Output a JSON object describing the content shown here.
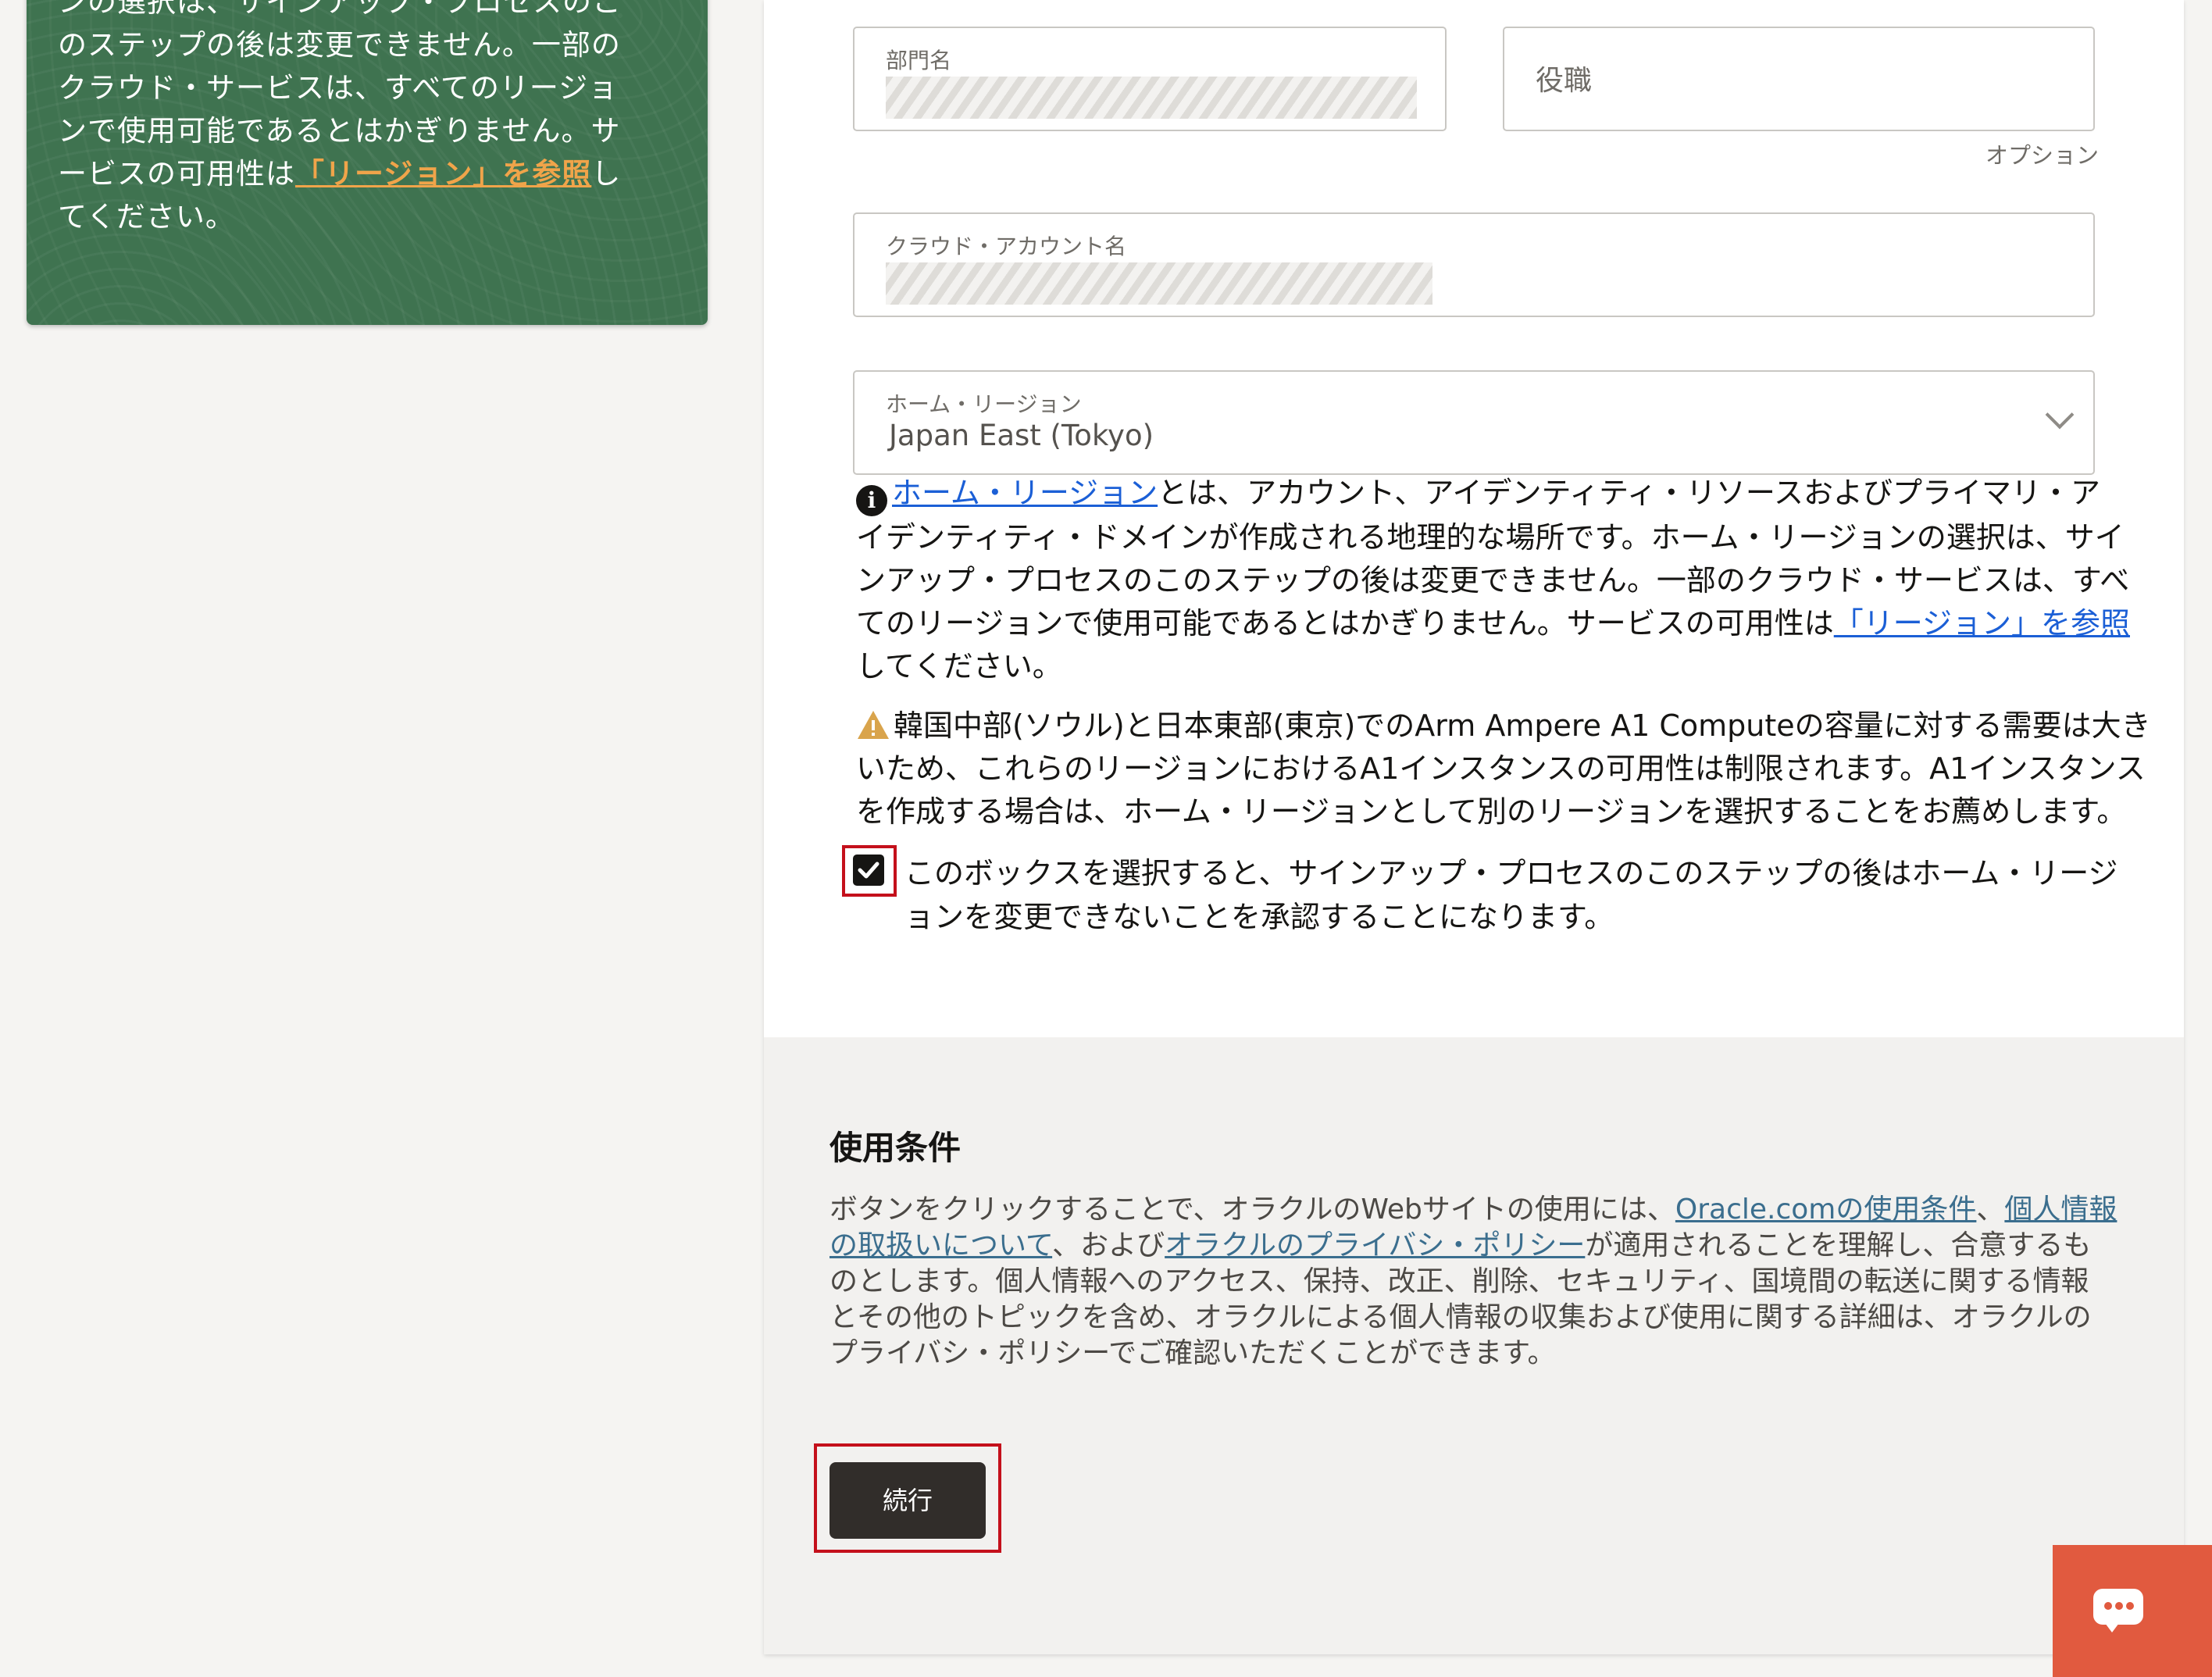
{
  "sidebar_note": {
    "lines": [
      "ンの選択は、サインアップ・プロセスのこ",
      "のステップの後は変更できません。一部の",
      "クラウド・サービスは、すべてのリージョ",
      "ンで使用可能であるとはかぎりません。サ"
    ],
    "line5_prefix": "ービスの可用性は",
    "line5_link": "「リージョン」を参照",
    "line5_suffix": "し",
    "line6": "てください。"
  },
  "form": {
    "department": {
      "label": "部門名"
    },
    "job_title": {
      "placeholder": "役職",
      "optional_label": "オプション"
    },
    "cloud_account": {
      "label": "クラウド・アカウント名"
    },
    "home_region": {
      "label": "ホーム・リージョン",
      "value": "Japan East (Tokyo)"
    }
  },
  "info_note": {
    "link_text": "ホーム・リージョン",
    "line1_rest": "とは、アカウント、アイデンティティ・リソースおよびプライマリ・ア",
    "line2": "イデンティティ・ドメインが作成される地理的な場所です。ホーム・リージョンの選択は、サイ",
    "line3": "ンアップ・プロセスのこのステップの後は変更できません。一部のクラウド・サービスは、すべ",
    "line4_prefix": "てのリージョンで使用可能であるとはかぎりません。サービスの可用性は",
    "line4_link": "「リージョン」を参照",
    "line5": "してください。"
  },
  "warning_note": {
    "line1": "韓国中部(ソウル)と日本東部(東京)でのArm Ampere A1 Computeの容量に対する需要は大き",
    "line2": "いため、これらのリージョンにおけるA1インスタンスの可用性は制限されます。A1インスタンス",
    "line3": "を作成する場合は、ホーム・リージョンとして別のリージョンを選択することをお薦めします。"
  },
  "acknowledge": {
    "checked": true,
    "line1": "このボックスを選択すると、サインアップ・プロセスのこのステップの後はホーム・リージ",
    "line2": "ョンを変更できないことを承認することになります。"
  },
  "terms": {
    "title": "使用条件",
    "line1_prefix": "ボタンをクリックすることで、オラクルのWebサイトの使用には、",
    "link_terms": "Oracle.comの使用条件",
    "sep": "、",
    "link_privacy_a": "個人情報",
    "link_privacy_b": "の取扱いについて",
    "line2_mid": "、および",
    "link_policy": "オラクルのプライバシ・ポリシー",
    "line2_suffix": "が適用されることを理解し、合意するも",
    "line3": "のとします。個人情報へのアクセス、保持、改正、削除、セキュリティ、国境間の転送に関する情報",
    "line4": "とその他のトピックを含め、オラクルによる個人情報の収集および使用に関する詳細は、オラクルの",
    "line5": "プライバシ・ポリシーでご確認いただくことができます。"
  },
  "continue_button": {
    "label": "続行"
  },
  "icons": {
    "info": "info-icon",
    "warning": "warning-icon",
    "chevron": "chevron-down-icon",
    "chat": "chat-icon"
  },
  "colors": {
    "sidebar_bg": "#3f7350",
    "sidebar_link": "#f0a44a",
    "link_blue": "#1b5fd6",
    "highlight_red": "#c4101b",
    "button_dark": "#312d2a",
    "chat_orange": "#e15a3f"
  }
}
